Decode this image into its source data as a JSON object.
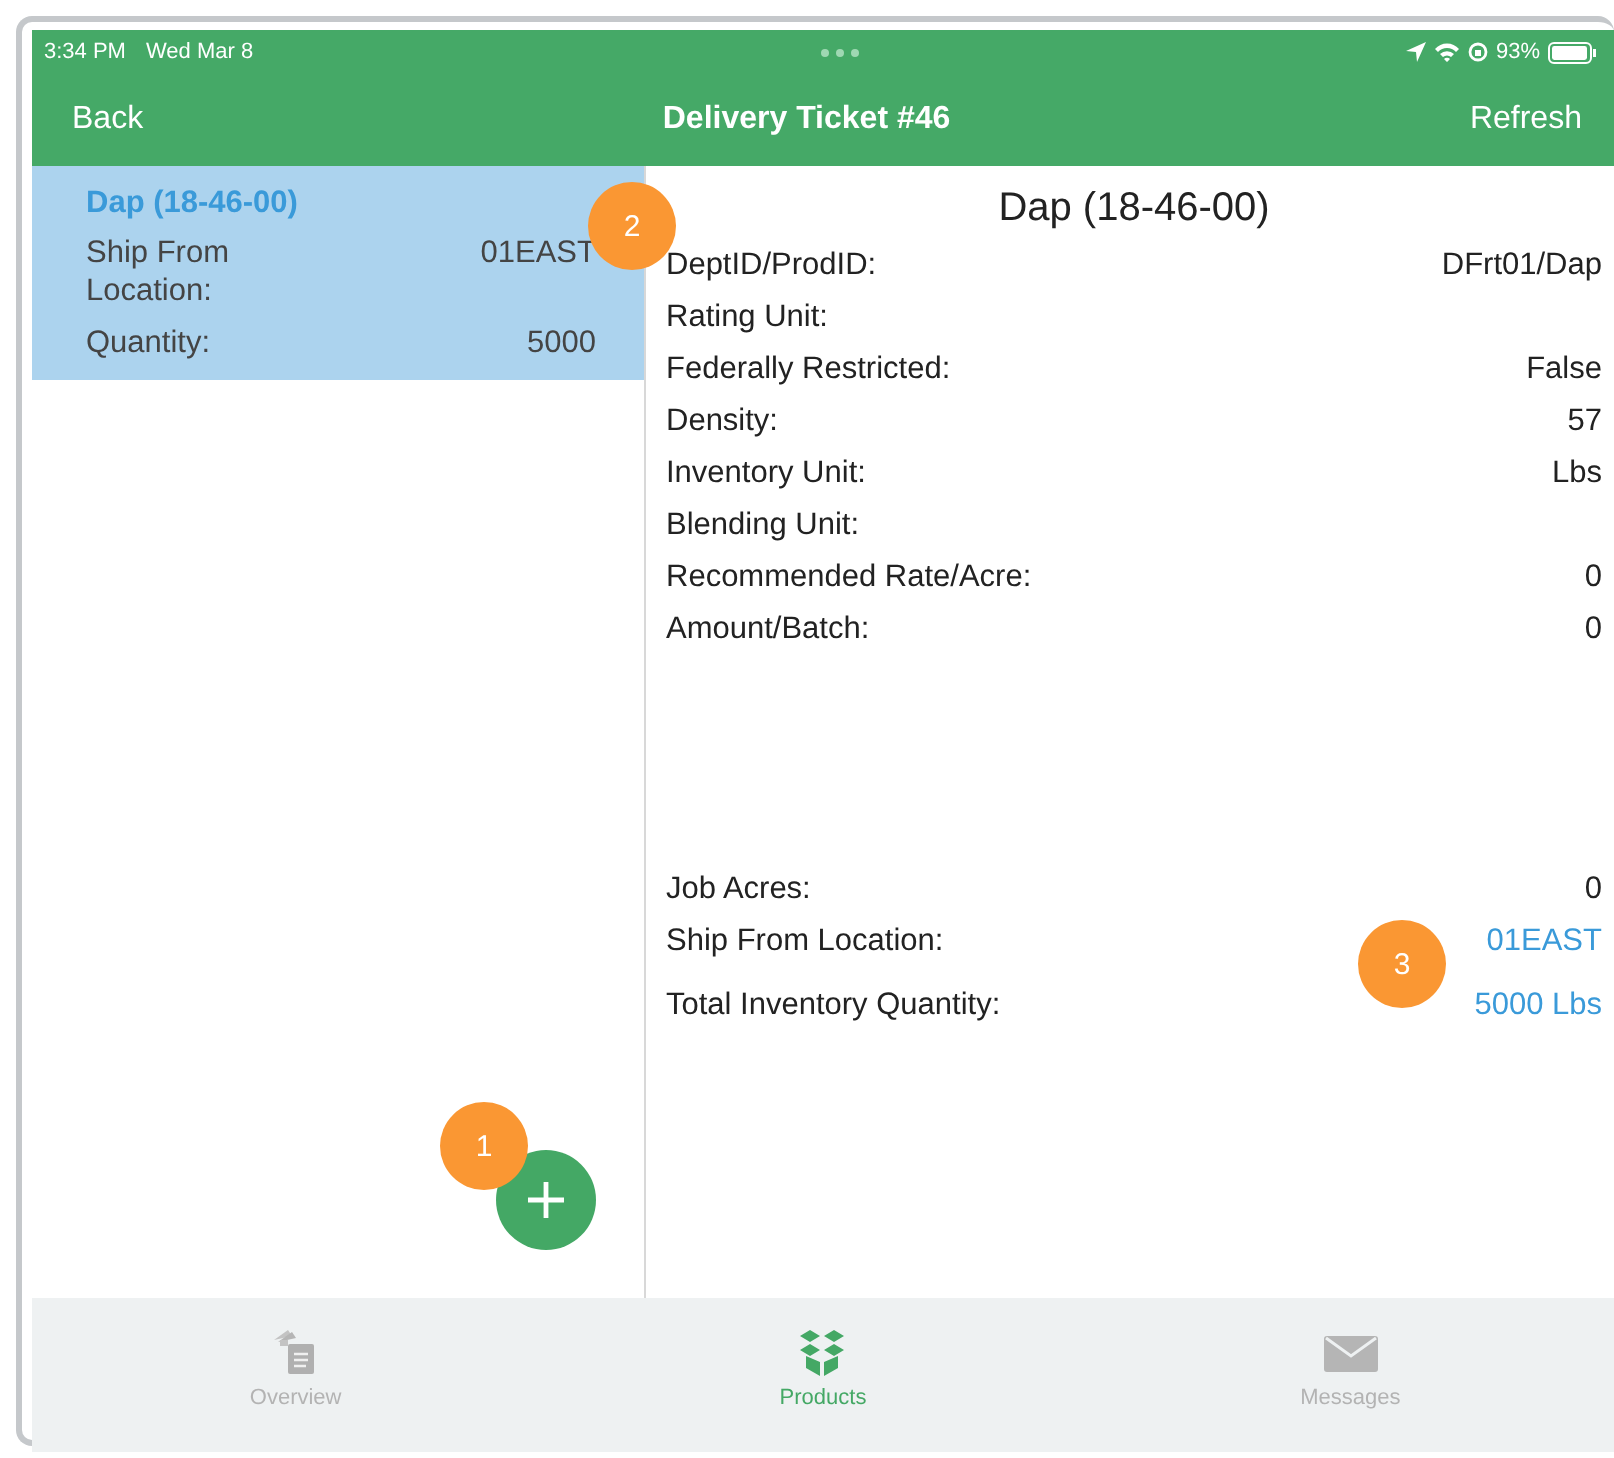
{
  "status_bar": {
    "time": "3:34 PM",
    "date": "Wed Mar 8",
    "battery": "93%"
  },
  "nav": {
    "back": "Back",
    "title": "Delivery Ticket #46",
    "action": "Refresh"
  },
  "product_list": [
    {
      "name": "Dap (18-46-00)",
      "selected": true,
      "fields": [
        {
          "label": "Ship From Location:",
          "value": "01EAST"
        },
        {
          "label": "Quantity:",
          "value": "5000"
        }
      ]
    }
  ],
  "detail": {
    "title": "Dap (18-46-00)",
    "rows": [
      {
        "label": "DeptID/ProdID:",
        "value": "DFrt01/Dap"
      },
      {
        "label": "Rating Unit:"
      },
      {
        "label": "Federally Restricted:",
        "value": "False"
      },
      {
        "label": "Density:",
        "value": "57"
      },
      {
        "label": "Inventory Unit:",
        "value": "Lbs"
      },
      {
        "label": "Blending Unit:"
      },
      {
        "label": "Recommended Rate/Acre:",
        "value": "0"
      },
      {
        "label": "Amount/Batch:",
        "value": "0"
      }
    ],
    "summary": [
      {
        "label": "Job Acres:",
        "value": "0",
        "link": false
      },
      {
        "label": "Ship From Location:",
        "value": "01EAST",
        "link": true
      },
      {
        "label": "Total Inventory Quantity:",
        "value": "5000 Lbs",
        "link": true
      }
    ]
  },
  "tabs": [
    {
      "label": "Overview",
      "kind": "documents",
      "selected": false
    },
    {
      "label": "Products",
      "kind": "box",
      "selected": true
    },
    {
      "label": "Messages",
      "kind": "mail",
      "selected": false
    }
  ],
  "callouts": [
    {
      "text": "1",
      "kind": "add"
    },
    {
      "text": "2",
      "kind": "list"
    },
    {
      "text": "3",
      "kind": "detail"
    }
  ]
}
